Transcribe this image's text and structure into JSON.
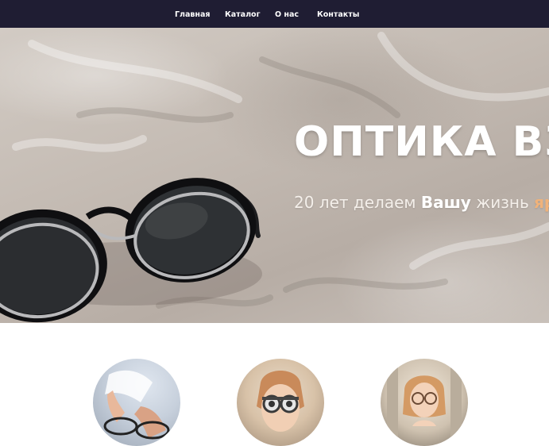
{
  "nav": {
    "items": [
      {
        "label": "Главная"
      },
      {
        "label": "Каталог"
      },
      {
        "label": "О нас"
      },
      {
        "label": "Контакты"
      }
    ]
  },
  "hero": {
    "title": "ОПТИКА ВЗ",
    "subtitle_pre": "20 лет делаем ",
    "subtitle_bold": "Вашу",
    "subtitle_mid": " жизнь ",
    "subtitle_highlight": "яр",
    "highlight_color": "#f0b27a"
  },
  "colors": {
    "nav_bg": "#1f1d33",
    "hero_bg": "#c4bbb3"
  },
  "photos": [
    {
      "icon": "doctor-hands-glasses-photo"
    },
    {
      "icon": "eye-exam-trial-frame-photo"
    },
    {
      "icon": "woman-with-glasses-photo"
    }
  ]
}
